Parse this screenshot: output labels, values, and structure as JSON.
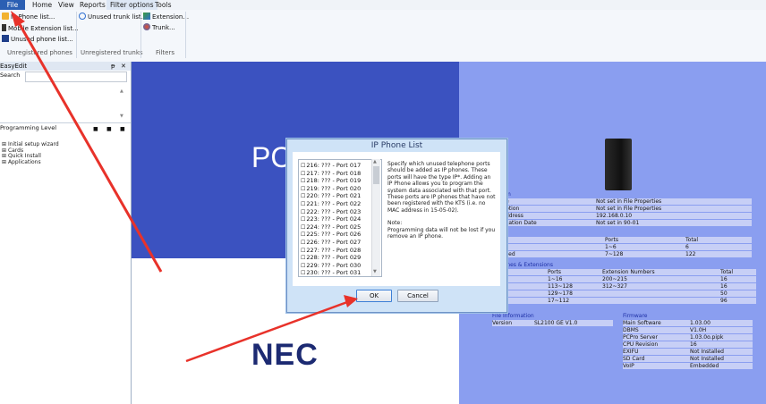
{
  "menubar": {
    "items": [
      "File",
      "Home",
      "View",
      "Reports",
      "Filter options",
      "Tools"
    ]
  },
  "ribbon": {
    "phones_group": {
      "label": "Unregistered phones",
      "buttons": [
        "IP Phone list...",
        "Mobile Extension list...",
        "Unused phone list..."
      ]
    },
    "trunks_group": {
      "label": "Unregistered trunks",
      "buttons": [
        "Unused trunk list..."
      ]
    },
    "filters_group": {
      "label": "Filters",
      "buttons": [
        "Extension...",
        "Trunk..."
      ]
    }
  },
  "easyedit": {
    "title": "EasyEdit",
    "pin": "ᵽ",
    "close": "✕",
    "search_label": "Search",
    "programming_level_label": "Programming Level",
    "tree": [
      "Initial setup wizard",
      "Cards",
      "Quick Install",
      "Applications"
    ]
  },
  "main": {
    "pc_text": "PC",
    "nec_logo": "NEC"
  },
  "system_table": {
    "header_suffix": "m",
    "rows": [
      {
        "label": "e",
        "value": "Not set in File Properties"
      },
      {
        "label": "ption",
        "value": "Not set in File Properties"
      },
      {
        "label": "ddress",
        "value": "192.168.0.10"
      },
      {
        "label": "llation Date",
        "value": "Not set in 90-01"
      }
    ]
  },
  "ports_table": {
    "header": "s",
    "columns": [
      "",
      "Ports",
      "Total"
    ],
    "rows": [
      [
        "",
        "1~6",
        "6"
      ],
      [
        "sed",
        "7~128",
        "122"
      ]
    ]
  },
  "phones_table": {
    "header": "phones & Extensions",
    "columns": [
      "",
      "Ports",
      "Extension Numbers",
      "Total"
    ],
    "rows": [
      [
        "",
        "1~16",
        "200~215",
        "16"
      ],
      [
        "l",
        "113~128",
        "312~327",
        "16"
      ],
      [
        "",
        "129~178",
        "",
        "50"
      ],
      [
        "sed",
        "17~112",
        "",
        "96"
      ]
    ]
  },
  "file_info": {
    "header": "File Information",
    "version_label": "Version",
    "version_value": "SL2100 GE V1.0"
  },
  "firmware": {
    "header": "Firmware",
    "rows": [
      {
        "label": "Main Software",
        "value": "1.03.00"
      },
      {
        "label": "DBMS",
        "value": "V1.0H"
      },
      {
        "label": "PCPro Server",
        "value": "1.03.0o.pipk"
      },
      {
        "label": "CPU Revision",
        "value": "16"
      },
      {
        "label": "EXIFU",
        "value": "Not Installed"
      },
      {
        "label": "SD Card",
        "value": "Not Installed"
      },
      {
        "label": "VoIP",
        "value": "Embedded"
      }
    ]
  },
  "dialog": {
    "title": "IP Phone List",
    "ports": [
      "216: ??? - Port 017",
      "217: ??? - Port 018",
      "218: ??? - Port 019",
      "219: ??? - Port 020",
      "220: ??? - Port 021",
      "221: ??? - Port 022",
      "222: ??? - Port 023",
      "223: ??? - Port 024",
      "224: ??? - Port 025",
      "225: ??? - Port 026",
      "226: ??? - Port 027",
      "227: ??? - Port 028",
      "228: ??? - Port 029",
      "229: ??? - Port 030",
      "230: ??? - Port 031"
    ],
    "description": "Specify which unused telephone ports should be added as IP phones. These ports will have the type IP*. Adding an IP Phone allows you to program the system data associated with that port. These ports are IP phones that have not been registered with the KTS (i.e. no MAC address in 15-05-02).",
    "note_label": "Note:",
    "note_text": "Programming data will not be lost if you remove an IP phone.",
    "ok_label": "OK",
    "cancel_label": "Cancel"
  },
  "colors": {
    "accent": "#2b5fb3",
    "annotation_arrow": "#e8322a",
    "main_blue": "#3b52c0",
    "right_panel": "#8a9ef0"
  }
}
